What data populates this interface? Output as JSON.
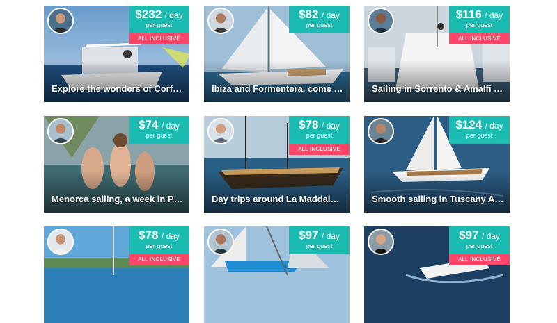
{
  "listings": [
    {
      "title": "Explore the wonders of Corfu in ...",
      "price": "$232",
      "unit": "/ day",
      "per": "per guest",
      "badge": "ALL INCLUSIVE"
    },
    {
      "title": "Ibiza and Formentera, come and ...",
      "price": "$82",
      "unit": "/ day",
      "per": "per guest",
      "badge": ""
    },
    {
      "title": "Sailing in Sorrento & Amalfi Coast",
      "price": "$116",
      "unit": "/ day",
      "per": "per guest",
      "badge": "ALL INCLUSIVE"
    },
    {
      "title": "Menorca sailing, a week in Parad...",
      "price": "$74",
      "unit": "/ day",
      "per": "per guest",
      "badge": ""
    },
    {
      "title": "Day trips around La Maddalena A...",
      "price": "$78",
      "unit": "/ day",
      "per": "per guest",
      "badge": "ALL INCLUSIVE"
    },
    {
      "title": "Smooth sailing in Tuscany Archip...",
      "price": "$124",
      "unit": "/ day",
      "per": "per guest",
      "badge": ""
    },
    {
      "title": "",
      "price": "$78",
      "unit": "/ day",
      "per": "per guest",
      "badge": "ALL INCLUSIVE"
    },
    {
      "title": "",
      "price": "$97",
      "unit": "/ day",
      "per": "per guest",
      "badge": ""
    },
    {
      "title": "",
      "price": "$97",
      "unit": "/ day",
      "per": "per guest",
      "badge": "ALL INCLUSIVE"
    }
  ],
  "colors": {
    "price_box": "#1bbbb2",
    "badge": "#ff4668",
    "title_text": "#ffffff"
  },
  "icons": {
    "avatar": "host-avatar-photo"
  }
}
